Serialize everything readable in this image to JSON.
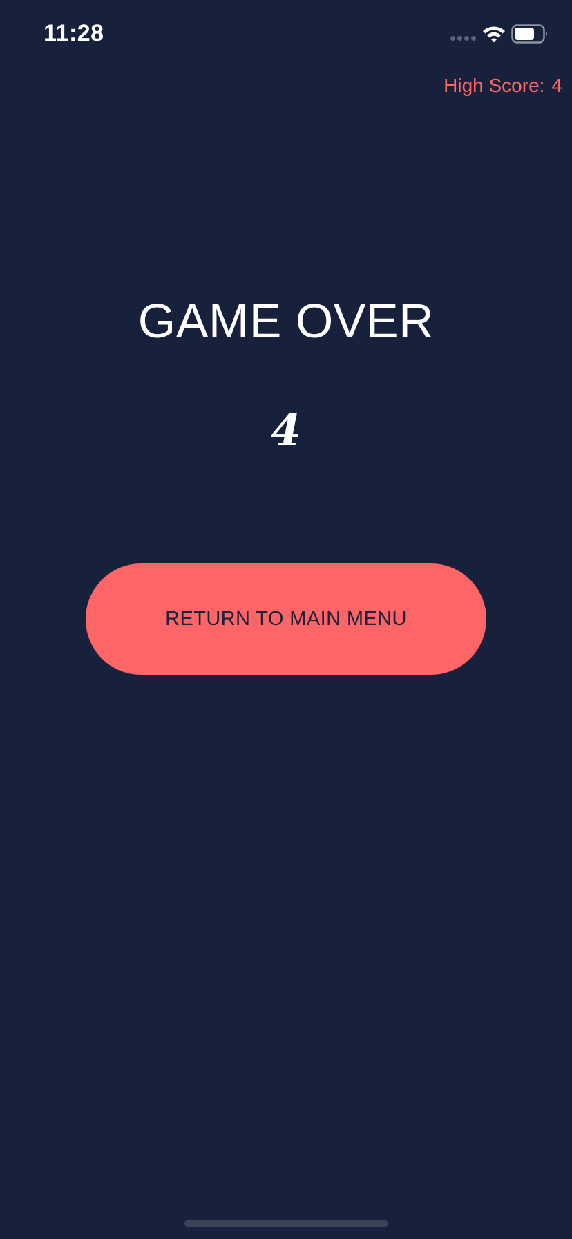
{
  "status_bar": {
    "time": "11:28",
    "signal_icon": "cellular-signal-dots",
    "wifi_icon": "wifi-icon",
    "battery_icon": "battery-icon",
    "battery_level": 0.7
  },
  "header": {
    "high_score_label": "High Score:",
    "high_score_value": "4"
  },
  "main": {
    "title": "GAME OVER",
    "score": "4",
    "return_button_label": "RETURN TO MAIN MENU"
  },
  "colors": {
    "background": "#18213b",
    "accent": "#fd6566",
    "button_text": "#1b223a",
    "text": "#ffffff"
  }
}
